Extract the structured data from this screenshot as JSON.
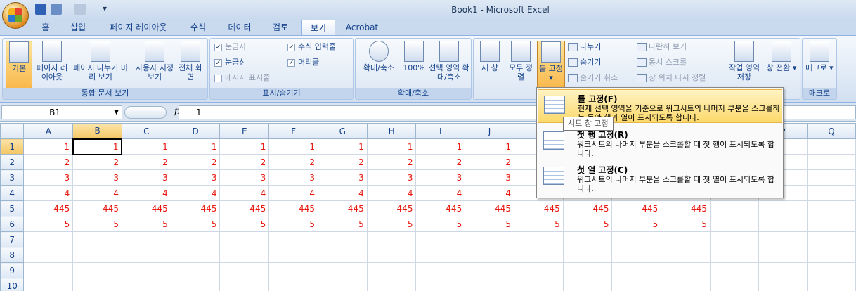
{
  "window": {
    "title": "Book1 - Microsoft Excel"
  },
  "tabs": [
    "홈",
    "삽입",
    "페이지 레이아웃",
    "수식",
    "데이터",
    "검토",
    "보기",
    "Acrobat"
  ],
  "ribbon": {
    "workbook_views": {
      "label": "통합 문서 보기",
      "normal": "기본",
      "page_layout": "페이지 레이아웃",
      "page_break": "페이지 나누기 미리 보기",
      "custom": "사용자 지정 보기",
      "fullscreen": "전체 화면"
    },
    "show_hide": {
      "label": "표시/숨기기",
      "ruler": "눈금자",
      "gridlines": "눈금선",
      "message_bar": "메시지 표시줄",
      "formula_bar": "수식 입력줄",
      "headings": "머리글"
    },
    "zoom": {
      "label": "확대/축소",
      "zoom": "확대/축소",
      "zoom100": "100%",
      "zoom_sel": "선택 영역 확대/축소"
    },
    "window": {
      "new_window": "새 창",
      "arrange_all": "모두 정렬",
      "freeze": "틀 고정",
      "split": "나누기",
      "hide": "숨기기",
      "unhide": "숨기기 취소",
      "side_by_side": "나란히 보기",
      "sync_scroll": "동시 스크롤",
      "reset_pos": "창 위치 다시 정렬",
      "save_ws": "작업 영역 저장",
      "switch": "창 전환"
    },
    "macros": {
      "label": "매크로",
      "macros": "매크로"
    }
  },
  "formula_bar": {
    "name_box": "B1",
    "fx": "fx",
    "value": "1"
  },
  "columns": [
    "A",
    "B",
    "C",
    "D",
    "E",
    "F",
    "G",
    "H",
    "I",
    "J",
    "K",
    "L",
    "M",
    "N",
    "O",
    "P",
    "Q"
  ],
  "rows": [
    {
      "n": "1",
      "cells": [
        "1",
        "1",
        "1",
        "1",
        "1",
        "1",
        "1",
        "1",
        "1",
        "1",
        "",
        "",
        "",
        "",
        "",
        "",
        ""
      ]
    },
    {
      "n": "2",
      "cells": [
        "2",
        "2",
        "2",
        "2",
        "2",
        "2",
        "2",
        "2",
        "2",
        "2",
        "",
        "",
        "",
        "",
        "",
        "",
        ""
      ]
    },
    {
      "n": "3",
      "cells": [
        "3",
        "3",
        "3",
        "3",
        "3",
        "3",
        "3",
        "3",
        "3",
        "3",
        "",
        "",
        "",
        "",
        "",
        "",
        ""
      ]
    },
    {
      "n": "4",
      "cells": [
        "4",
        "4",
        "4",
        "4",
        "4",
        "4",
        "4",
        "4",
        "4",
        "4",
        "",
        "",
        "",
        "",
        "",
        "",
        ""
      ]
    },
    {
      "n": "5",
      "cells": [
        "445",
        "445",
        "445",
        "445",
        "445",
        "445",
        "445",
        "445",
        "445",
        "445",
        "445",
        "445",
        "445",
        "445",
        "",
        "",
        ""
      ]
    },
    {
      "n": "6",
      "cells": [
        "5",
        "5",
        "5",
        "5",
        "5",
        "5",
        "5",
        "5",
        "5",
        "5",
        "5",
        "5",
        "5",
        "5",
        "",
        "",
        ""
      ]
    },
    {
      "n": "7",
      "cells": [
        "",
        "",
        "",
        "",
        "",
        "",
        "",
        "",
        "",
        "",
        "",
        "",
        "",
        "",
        "",
        "",
        ""
      ]
    },
    {
      "n": "8",
      "cells": [
        "",
        "",
        "",
        "",
        "",
        "",
        "",
        "",
        "",
        "",
        "",
        "",
        "",
        "",
        "",
        "",
        ""
      ]
    },
    {
      "n": "9",
      "cells": [
        "",
        "",
        "",
        "",
        "",
        "",
        "",
        "",
        "",
        "",
        "",
        "",
        "",
        "",
        "",
        "",
        ""
      ]
    },
    {
      "n": "10",
      "cells": [
        "",
        "",
        "",
        "",
        "",
        "",
        "",
        "",
        "",
        "",
        "",
        "",
        "",
        "",
        "",
        "",
        ""
      ]
    }
  ],
  "dropdown": {
    "items": [
      {
        "title": "틀 고정(F)",
        "desc": "현재 선택 영역을 기준으로 워크시트의 나머지 부분을 스크롤하는 동안 행과 열이 표시되도록 합니다."
      },
      {
        "title": "첫 행 고정(R)",
        "desc": "워크시트의 나머지 부분을 스크롤할 때 첫 행이 표시되도록 합니다."
      },
      {
        "title": "첫 열 고정(C)",
        "desc": "워크시트의 나머지 부분을 스크롤할 때 첫 열이 표시되도록 합니다."
      }
    ]
  },
  "tooltip": "시트 창 고정",
  "colors": {
    "value_text": "#e8180f",
    "ribbon_blue": "#15428b"
  }
}
